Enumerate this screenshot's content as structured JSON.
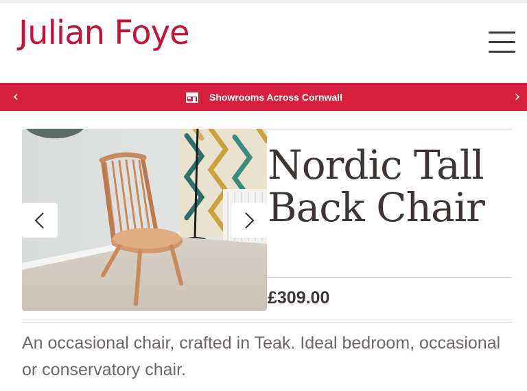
{
  "header": {
    "logo_text": "Julian Foye",
    "menu_icon": "hamburger-menu-icon"
  },
  "banner": {
    "message": "Showrooms Across Cornwall",
    "prev_icon": "chevron-left-icon",
    "next_icon": "chevron-right-icon",
    "prev_glyph": "‹",
    "next_glyph": "›",
    "shop_icon": "storefront-icon",
    "color": "#d81f3f"
  },
  "product": {
    "title_line1": "Nordic Tall",
    "title_line2": "Back Chair",
    "price": "£309.00",
    "description": "An occasional chair, crafted in Teak. Ideal bedroom, occasional or conservatory chair."
  },
  "gallery": {
    "image_subject": "wooden-spindle-back-chair-photo",
    "prev_icon": "chevron-left-icon",
    "next_icon": "chevron-right-icon"
  },
  "colors": {
    "brand": "#c4123b",
    "text": "#3d3533",
    "muted": "#6d6766"
  }
}
